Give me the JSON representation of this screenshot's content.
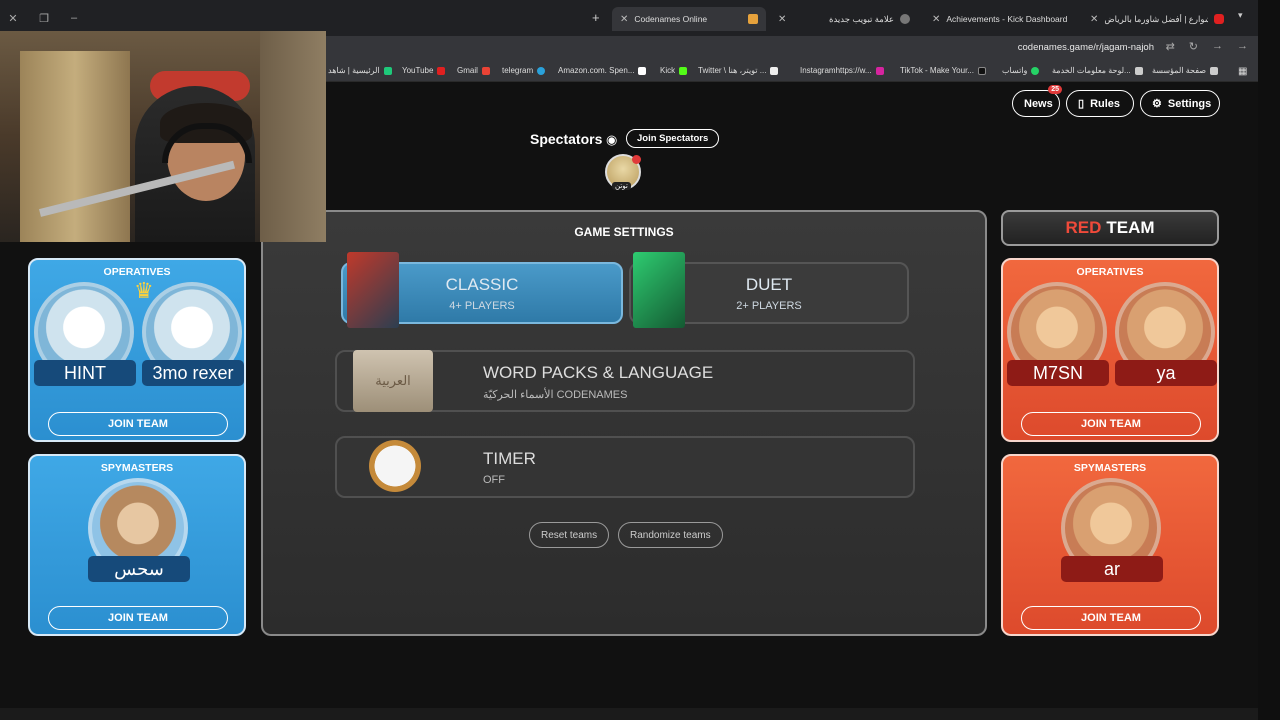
{
  "browser": {
    "tabs": [
      {
        "label": "Codenames Online",
        "active": true
      },
      {
        "label": "علامة تبويب جديدة",
        "active": false
      },
      {
        "label": "Achievements - Kick Dashboard",
        "active": false
      },
      {
        "label": "أكل الشوارع | أفضل شاورما بالرياض",
        "active": false
      }
    ],
    "url": "codenames.game/r/jagam-najoh",
    "bookmarks": [
      "الرئيسية | شاهد",
      "YouTube",
      "Gmail",
      "telegram",
      "Amazon.com. Spen...",
      "Kick",
      "Twitter \\ تويتر، هنا ...",
      "Instagramhttps://w...",
      "TikTok - Make Your...",
      "واتساب",
      "لوحة معلومات الخدمة...",
      "صفحة المؤسسة"
    ],
    "colors": {
      "tabbar": "#202124",
      "toolbar": "#35363a"
    }
  },
  "header": {
    "news_label": "News",
    "news_badge": "25",
    "rules_label": "Rules",
    "settings_label": "Settings"
  },
  "spectators": {
    "title": "Spectators",
    "join_label": "Join Spectators",
    "members": [
      "توتن"
    ]
  },
  "blue_team": {
    "operatives_title": "OPERATIVES",
    "operatives": [
      "HINT",
      "3mo rexer"
    ],
    "operatives_join": "JOIN TEAM",
    "spymasters_title": "SPYMASTERS",
    "spymasters": [
      "سحس"
    ],
    "spymasters_join": "JOIN TEAM",
    "color": "#2b8fd0"
  },
  "red_team": {
    "title_red": "RED",
    "title_team": "TEAM",
    "operatives_title": "OPERATIVES",
    "operatives": [
      "M7SN",
      "ya"
    ],
    "operatives_join": "JOIN TEAM",
    "spymasters_title": "SPYMASTERS",
    "spymasters": [
      "ar"
    ],
    "spymasters_join": "JOIN TEAM",
    "color": "#dd4a2c"
  },
  "game_settings": {
    "title": "GAME SETTINGS",
    "modes": [
      {
        "label": "CLASSIC",
        "sub": "4+ PLAYERS",
        "selected": true
      },
      {
        "label": "DUET",
        "sub": "2+ PLAYERS",
        "selected": false
      }
    ],
    "word_packs": {
      "label": "WORD PACKS & LANGUAGE",
      "sub": "الأسماء الحركيّة CODENAMES",
      "box_text": "العربية"
    },
    "timer": {
      "label": "TIMER",
      "sub": "OFF"
    },
    "reset_label": "Reset teams",
    "randomize_label": "Randomize teams"
  }
}
